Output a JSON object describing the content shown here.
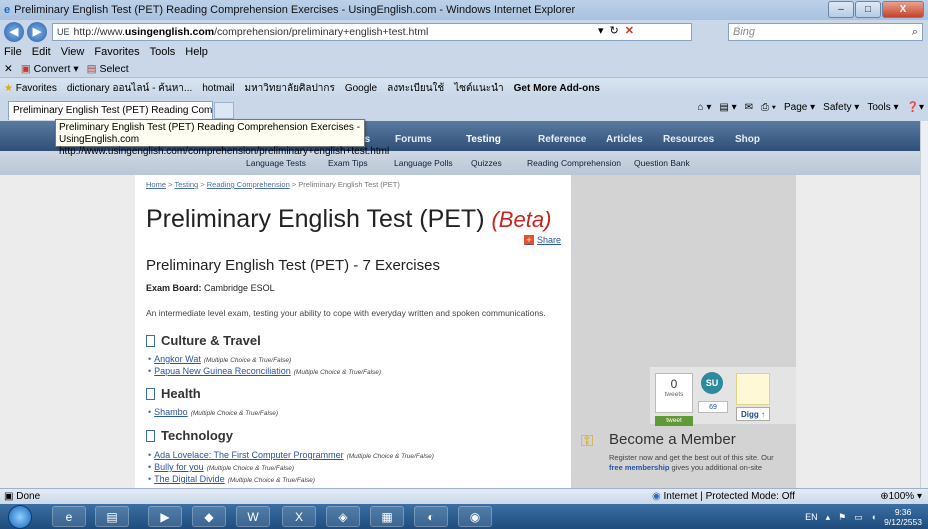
{
  "window": {
    "title": "Preliminary English Test (PET) Reading Comprehension Exercises - UsingEnglish.com - Windows Internet Explorer",
    "minimize": "–",
    "maximize": "□",
    "close": "X"
  },
  "address": {
    "url_prefix": "http://www.",
    "url_domain": "usingenglish.com",
    "url_path": "/comprehension/preliminary+english+test.html",
    "search_placeholder": "Bing"
  },
  "menu": [
    "File",
    "Edit",
    "View",
    "Favorites",
    "Tools",
    "Help"
  ],
  "toolbar2": {
    "convert": "Convert",
    "select": "Select"
  },
  "favorites": {
    "label": "Favorites",
    "items": [
      "dictionary ออนไลน์ - ค้นหา...",
      "hotmail",
      "มหาวิทยาลัยศิลปากร",
      "Google",
      "ลงทะเบียนใช้",
      "ไซต์แนะนำ",
      "Get More Add-ons"
    ]
  },
  "tab": {
    "label": "Preliminary English Test (PET) Reading Compreh..."
  },
  "commandbar": [
    "Page",
    "Safety",
    "Tools"
  ],
  "tooltip": {
    "line1": "Preliminary English Test (PET) Reading Comprehension Exercises - UsingEnglish.com",
    "line2": "http://www.usingenglish.com/comprehension/preliminary+english+test.html"
  },
  "sitenav": {
    "items": [
      "achers",
      "Forums",
      "Testing",
      "Reference",
      "Articles",
      "Resources",
      "Shop"
    ]
  },
  "subnav": {
    "items": [
      "Language Tests",
      "Exam Tips",
      "Language Polls",
      "Quizzes",
      "Reading Comprehension",
      "Question Bank"
    ]
  },
  "breadcrumb": {
    "home": "Home",
    "testing": "Testing",
    "reading": "Reading Comprehension",
    "current": "Preliminary English Test (PET)",
    "sep": " > "
  },
  "page": {
    "title": "Preliminary English Test (PET)",
    "beta": "(Beta)",
    "share": "Share",
    "subtitle": "Preliminary English Test (PET) - 7 Exercises",
    "board_label": "Exam Board:",
    "board_value": "Cambridge ESOL",
    "intro": "An intermediate level exam, testing your ability to cope with everyday written and spoken communications."
  },
  "sections": [
    {
      "title": "Culture & Travel",
      "items": [
        {
          "title": "Angkor Wat",
          "type": "(Multiple Choice & True/False)"
        },
        {
          "title": "Papua New Guinea Reconciliation",
          "type": "(Multiple Choice & True/False)"
        }
      ]
    },
    {
      "title": "Health",
      "items": [
        {
          "title": "Shambo",
          "type": "(Multiple Choice & True/False)"
        }
      ]
    },
    {
      "title": "Technology",
      "items": [
        {
          "title": "Ada Lovelace: The First Computer Programmer",
          "type": "(Multiple Choice & True/False)"
        },
        {
          "title": "Bully for you",
          "type": "(Multiple Choice & True/False)"
        },
        {
          "title": "The Digital Divide",
          "type": "(Multiple Choice & True/False)"
        }
      ]
    }
  ],
  "social": {
    "tweets_count": "0",
    "tweets_label": "tweets",
    "tweet_button": "tweet",
    "stumble_icon": "SU",
    "stumble_count": "69",
    "digg_button": "Digg"
  },
  "member": {
    "title": "Become a Member",
    "text_a": "Register now and get the best out of this site. Our",
    "text_b_bold": "free membership",
    "text_c": "gives you additional on-site"
  },
  "status": {
    "left": "Done",
    "zone": "Internet | Protected Mode: Off",
    "zoom": "100%"
  },
  "tray": {
    "lang": "EN",
    "time": "9:36",
    "date": "9/12/2553"
  }
}
